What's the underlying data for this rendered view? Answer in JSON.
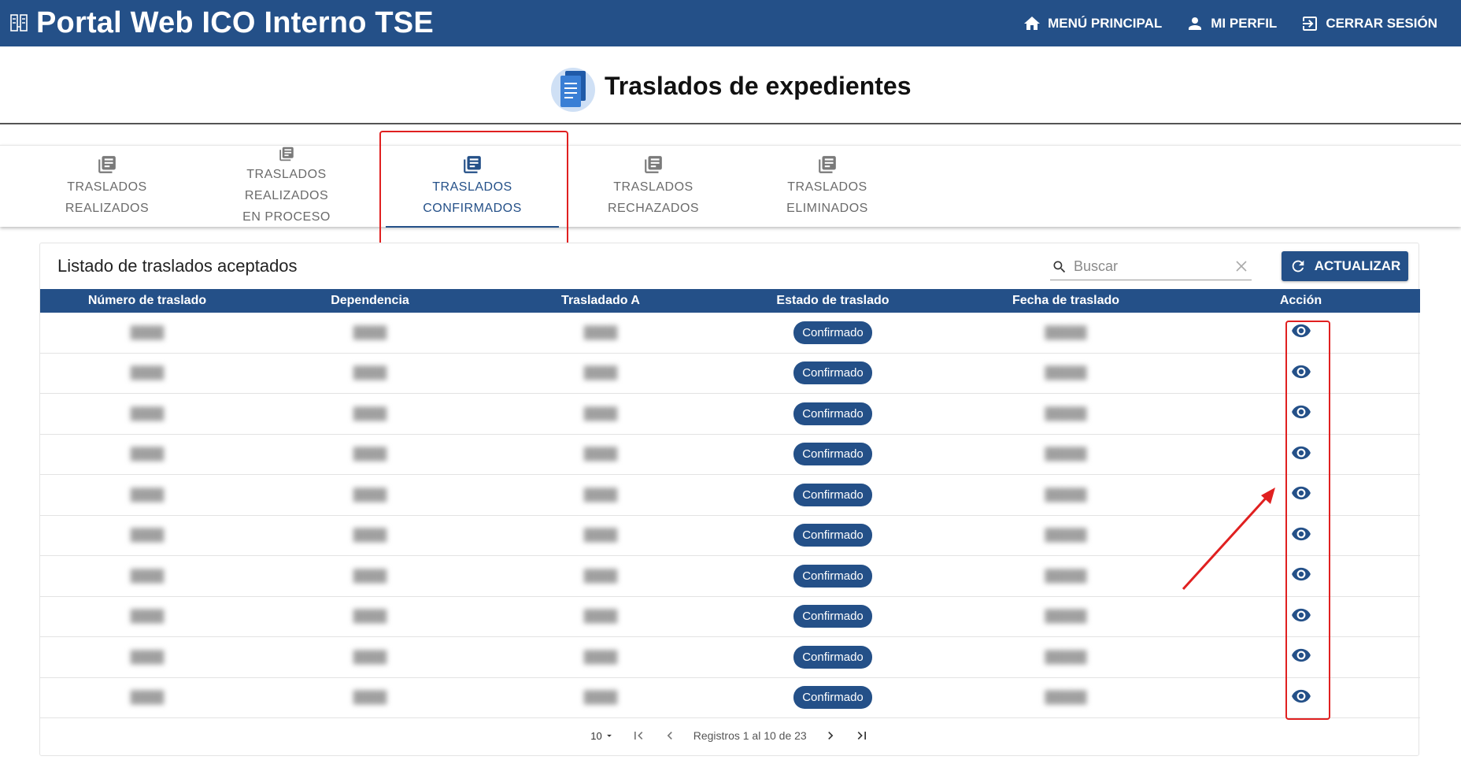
{
  "header": {
    "app_title": "Portal Web ICO Interno TSE",
    "nav": [
      {
        "label": "MENÚ PRINCIPAL",
        "icon": "home-icon"
      },
      {
        "label": "MI PERFIL",
        "icon": "user-icon"
      },
      {
        "label": "CERRAR SESIÓN",
        "icon": "logout-icon"
      }
    ]
  },
  "page": {
    "title": "Traslados de expedientes"
  },
  "tabs": [
    {
      "label": "TRASLADOS REALIZADOS",
      "active": false
    },
    {
      "label": "TRASLADOS REALIZADOS EN PROCESO",
      "line1": "TRASLADOS REALIZADOS",
      "line2": "EN PROCESO",
      "active": false
    },
    {
      "label": "TRASLADOS CONFIRMADOS",
      "active": true
    },
    {
      "label": "TRASLADOS RECHAZADOS",
      "active": false
    },
    {
      "label": "TRASLADOS ELIMINADOS",
      "active": false
    }
  ],
  "list": {
    "title": "Listado de traslados aceptados",
    "search_placeholder": "Buscar",
    "refresh_label": "ACTUALIZAR",
    "columns": [
      "Número de traslado",
      "Dependencia",
      "Trasladado A",
      "Estado de traslado",
      "Fecha de traslado",
      "Acción"
    ],
    "status_label": "Confirmado",
    "rows": [
      {
        "status": "Confirmado"
      },
      {
        "status": "Confirmado"
      },
      {
        "status": "Confirmado"
      },
      {
        "status": "Confirmado"
      },
      {
        "status": "Confirmado"
      },
      {
        "status": "Confirmado"
      },
      {
        "status": "Confirmado"
      },
      {
        "status": "Confirmado"
      },
      {
        "status": "Confirmado"
      },
      {
        "status": "Confirmado"
      }
    ]
  },
  "pagination": {
    "page_size": "10",
    "summary": "Registros 1 al 10 de 23"
  },
  "colors": {
    "primary": "#245088",
    "highlight": "#e02020"
  }
}
